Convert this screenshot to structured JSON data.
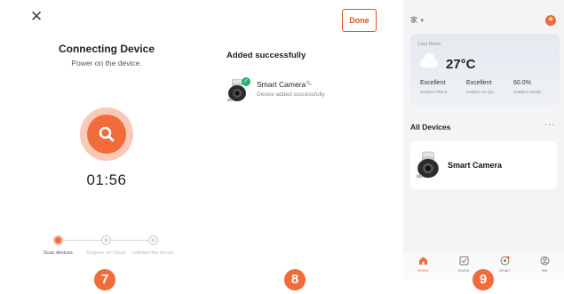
{
  "step_badges": [
    "7",
    "8",
    "9"
  ],
  "connecting": {
    "close_icon": "close-icon",
    "title": "Connecting Device",
    "subtitle": "Power on the device.",
    "scan_icon": "search-icon",
    "timer": "01:56",
    "steps": [
      {
        "label": "Scan devices.",
        "state": "active"
      },
      {
        "label": "Register on Cloud.",
        "state": "pending"
      },
      {
        "label": "Initialize the device.",
        "state": "pending"
      }
    ]
  },
  "added": {
    "done_label": "Done",
    "title": "Added successfully",
    "device": {
      "name": "Smart Camera",
      "status": "Device added successfully",
      "icon": "camera-icon",
      "check_icon": "check-icon",
      "edit_icon": "pencil-icon"
    }
  },
  "home": {
    "home_name": "家",
    "weather": {
      "location": "Cozy Home",
      "temperature": "27°C",
      "metrics": [
        {
          "value": "Excellent",
          "label": "Outdoor PM2.5"
        },
        {
          "value": "Excellent",
          "label": "Outdoor Air Qu..."
        },
        {
          "value": "60.0%",
          "label": "Outdoor Humid..."
        }
      ]
    },
    "section_title": "All Devices",
    "more_label": "···",
    "device_card_name": "Smart Camera",
    "tabs": [
      {
        "label": "Home",
        "icon": "home-icon",
        "active": true
      },
      {
        "label": "Scene",
        "icon": "scene-icon",
        "active": false
      },
      {
        "label": "Smart",
        "icon": "smart-icon",
        "active": false
      },
      {
        "label": "Me",
        "icon": "profile-icon",
        "active": false
      }
    ]
  },
  "colors": {
    "accent": "#f26b3a",
    "accent_light": "#f9c9b8",
    "success": "#21b36b",
    "done_border": "#e2502a"
  }
}
